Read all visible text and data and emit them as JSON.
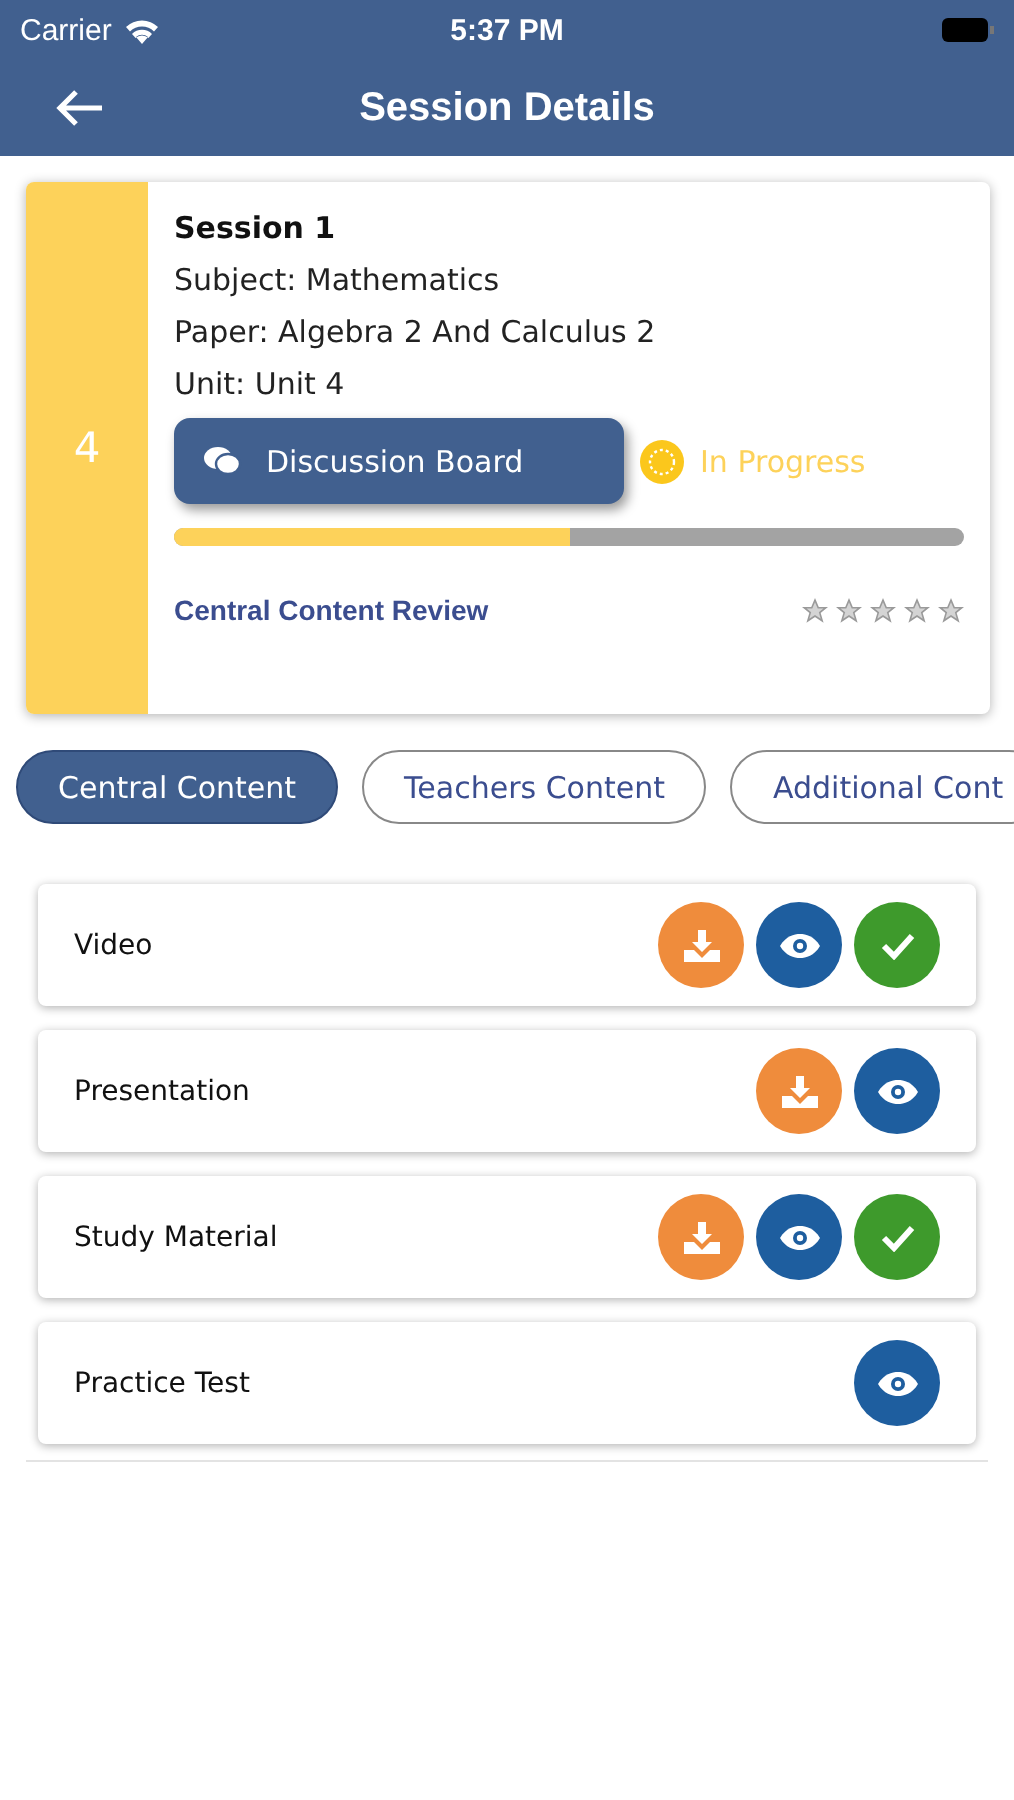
{
  "status_bar": {
    "carrier": "Carrier",
    "time": "5:37 PM"
  },
  "header": {
    "title": "Session Details"
  },
  "session": {
    "number": "4",
    "title": "Session 1",
    "details": [
      "Subject: Mathematics",
      "Paper: Algebra 2 And Calculus 2",
      "Unit: Unit 4"
    ],
    "discussion_button": "Discussion Board",
    "status": "In Progress",
    "progress": {
      "level": 0.5
    },
    "review_link": "Central Content Review",
    "stars": 0
  },
  "tabs": [
    {
      "label": "Central Content",
      "selected": true
    },
    {
      "label": "Teachers Content",
      "selected": false
    },
    {
      "label": "Additional Cont",
      "selected": false
    }
  ],
  "items": [
    {
      "label": "Video",
      "actions": [
        {
          "kind": "download"
        },
        {
          "kind": "view"
        },
        {
          "kind": "done"
        }
      ]
    },
    {
      "label": "Presentation",
      "actions": [
        {
          "kind": "download"
        },
        {
          "kind": "view"
        }
      ]
    },
    {
      "label": "Study Material",
      "actions": [
        {
          "kind": "download"
        },
        {
          "kind": "view"
        },
        {
          "kind": "done"
        }
      ]
    },
    {
      "label": "Practice Test",
      "actions": [
        {
          "kind": "view"
        }
      ]
    }
  ]
}
